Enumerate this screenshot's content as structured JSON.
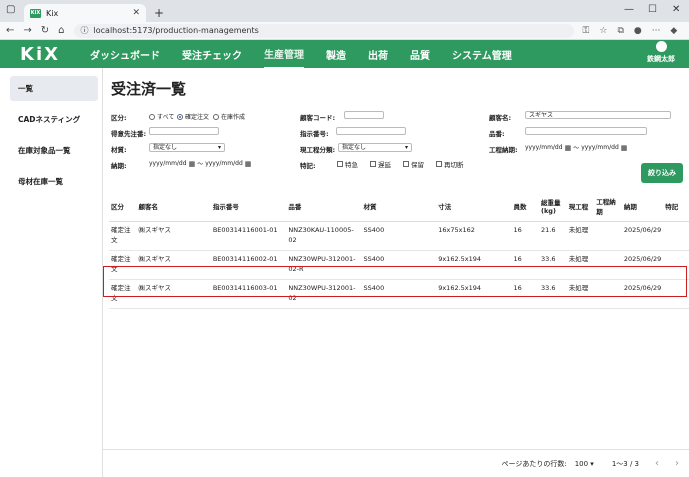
{
  "browser": {
    "tab_title": "Kix",
    "favicon_text": "KiX",
    "url": "localhost:5173/production-managements"
  },
  "app": {
    "logo": "KiX",
    "nav": [
      "ダッシュボード",
      "受注チェック",
      "生産管理",
      "製造",
      "出荷",
      "品質",
      "システム管理"
    ],
    "user_name": "鉄鋼太郎"
  },
  "sidebar": {
    "items": [
      "一覧",
      "CADネスティング",
      "在庫対象品一覧",
      "母材在庫一覧"
    ]
  },
  "page": {
    "title": "受注済一覧"
  },
  "filter": {
    "kubun_label": "区分:",
    "radio_all": "すべて",
    "radio_confirmed": "確定注文",
    "radio_stock": "在庫作成",
    "customer_code_label": "顧客コード:",
    "customer_name_label": "顧客名:",
    "customer_name_value": "スギヤス",
    "tokui_label": "得意先注番:",
    "shiji_label": "指示番号:",
    "hinban_label": "品番:",
    "zaishitsu_label": "材質:",
    "zaishitsu_value": "指定なし",
    "genkotei_label": "現工程分類:",
    "genkotei_value": "指定なし",
    "koutei_nouki_label": "工程納期:",
    "date_placeholder": "yyyy/mm/dd",
    "date_sep": "〜",
    "nouki_label": "納期:",
    "tokki_label": "特記:",
    "tokki_options": [
      "特急",
      "遅延",
      "保留",
      "再切断"
    ],
    "search_button": "絞り込み"
  },
  "table": {
    "headers": [
      "区分",
      "顧客名",
      "指示番号",
      "品番",
      "材質",
      "寸法",
      "員数",
      "総重量(kg)",
      "現工程",
      "工程納期",
      "納期",
      "特記"
    ],
    "rows": [
      [
        "確定注文",
        "㈱スギヤス",
        "BE00314116001-01",
        "NNZ30KAU-110005-02",
        "SS400",
        "16x75x162",
        "16",
        "21.6",
        "未処理",
        "",
        "2025/06/29",
        ""
      ],
      [
        "確定注文",
        "㈱スギヤス",
        "BE00314116002-01",
        "NNZ30WPU-312001-02-R",
        "SS400",
        "9x162.5x194",
        "16",
        "33.6",
        "未処理",
        "",
        "2025/06/29",
        ""
      ],
      [
        "確定注文",
        "㈱スギヤス",
        "BE00314116003-01",
        "NNZ30WPU-312001-02",
        "SS400",
        "9x162.5x194",
        "16",
        "33.6",
        "未処理",
        "",
        "2025/06/29",
        ""
      ]
    ]
  },
  "footer": {
    "rows_per_page_label": "ページあたりの行数:",
    "rows_per_page_value": "100",
    "range": "1〜3 / 3"
  }
}
